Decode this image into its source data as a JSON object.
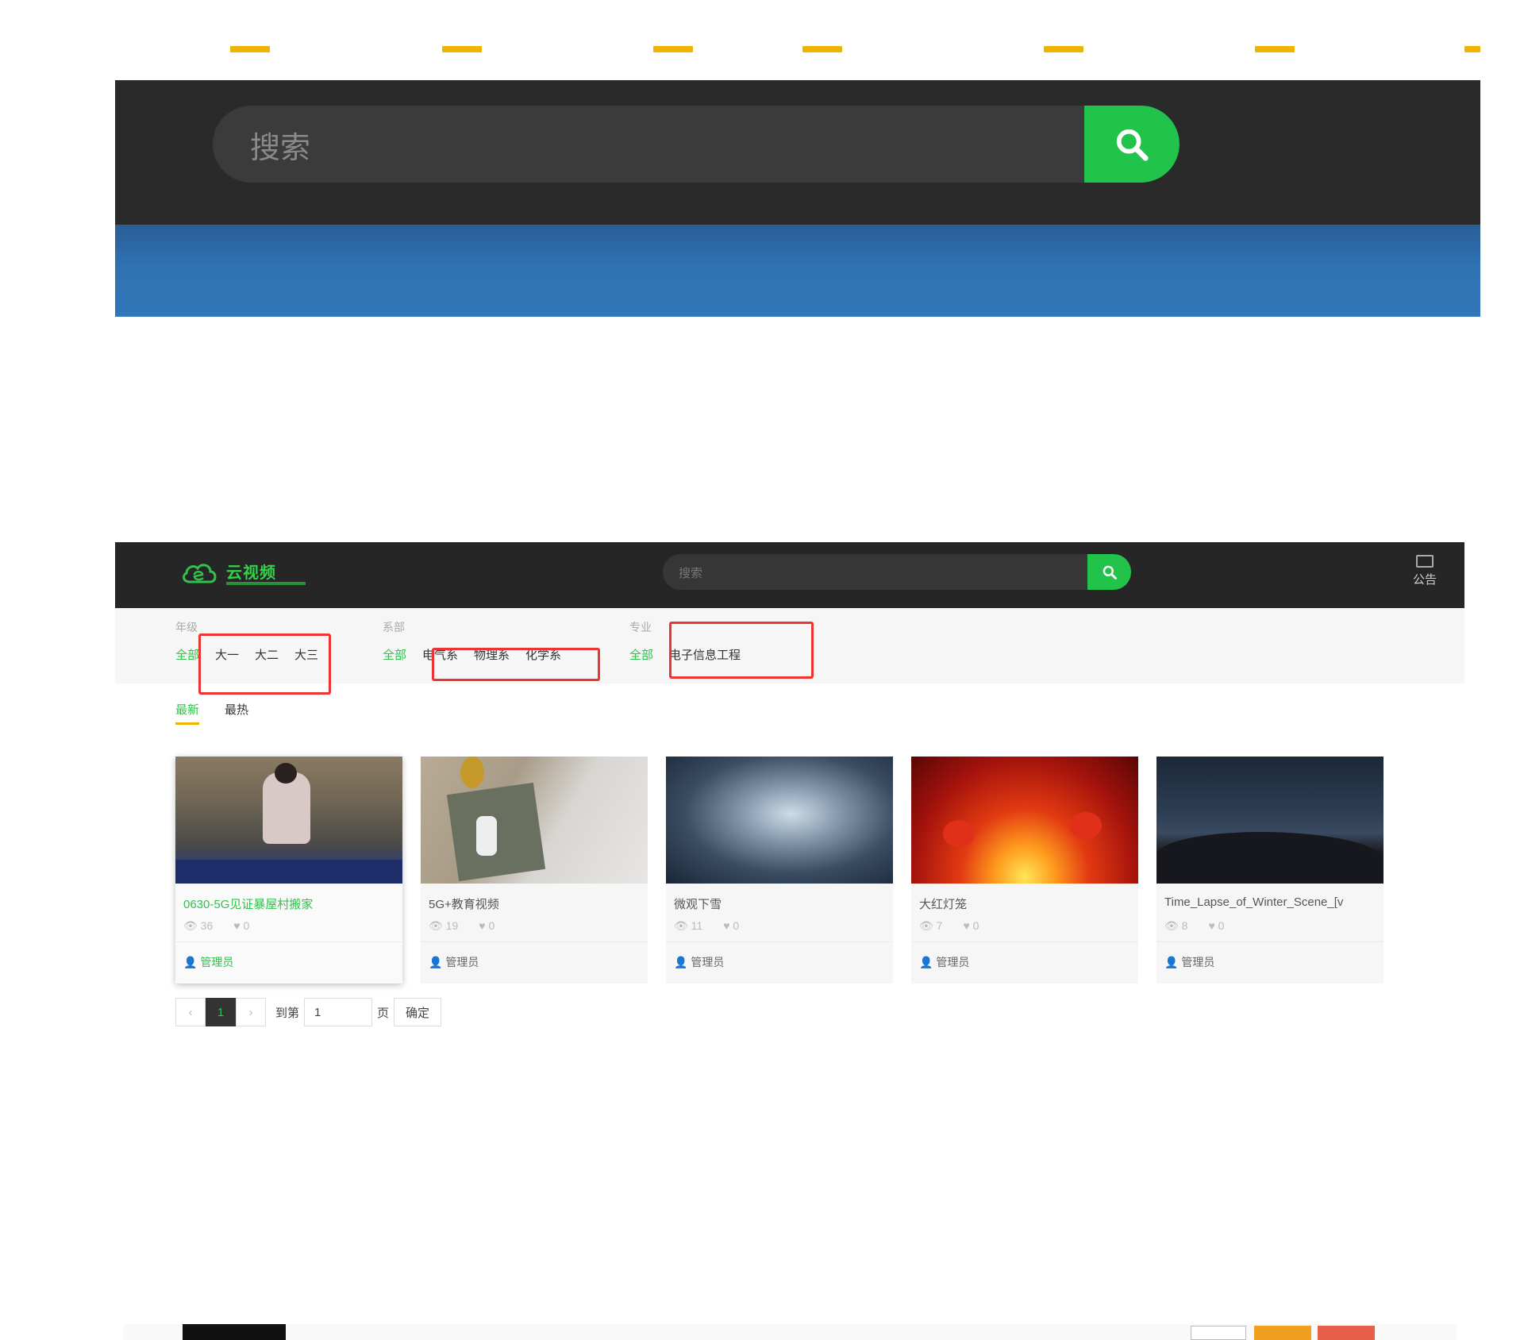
{
  "big_header": {
    "search_placeholder": "搜索",
    "colors": {
      "header_bg": "#2a2a2a",
      "search_button": "#22c34a",
      "banner": "#2f72b2"
    }
  },
  "site": {
    "logo_text": "云视频",
    "search_placeholder": "搜索",
    "notice_label": "公告"
  },
  "filters": [
    {
      "label": "年级",
      "options": [
        "全部",
        "大一",
        "大二",
        "大三"
      ]
    },
    {
      "label": "系部",
      "options": [
        "全部",
        "电气系",
        "物理系",
        "化学系"
      ]
    },
    {
      "label": "专业",
      "options": [
        "全部",
        "电子信息工程"
      ]
    }
  ],
  "sort_tabs": [
    "最新",
    "最热"
  ],
  "videos": [
    {
      "title": "0630-5G见证暴屋村搬家",
      "views": "36",
      "likes": "0",
      "author": "管理员"
    },
    {
      "title": "5G+教育视频",
      "views": "19",
      "likes": "0",
      "author": "管理员"
    },
    {
      "title": "微观下雪",
      "views": "11",
      "likes": "0",
      "author": "管理员"
    },
    {
      "title": "大红灯笼",
      "views": "7",
      "likes": "0",
      "author": "管理员"
    },
    {
      "title": "Time_Lapse_of_Winter_Scene_[v",
      "views": "8",
      "likes": "0",
      "author": "管理员"
    }
  ],
  "pagination": {
    "prev": "‹",
    "current": "1",
    "next": "›",
    "goto_label": "到第",
    "goto_value": "1",
    "page_unit": "页",
    "confirm": "确定"
  },
  "accent_colors": {
    "green": "#2fc24c",
    "orange": "#f0b400",
    "highlight_red": "#e33333"
  }
}
